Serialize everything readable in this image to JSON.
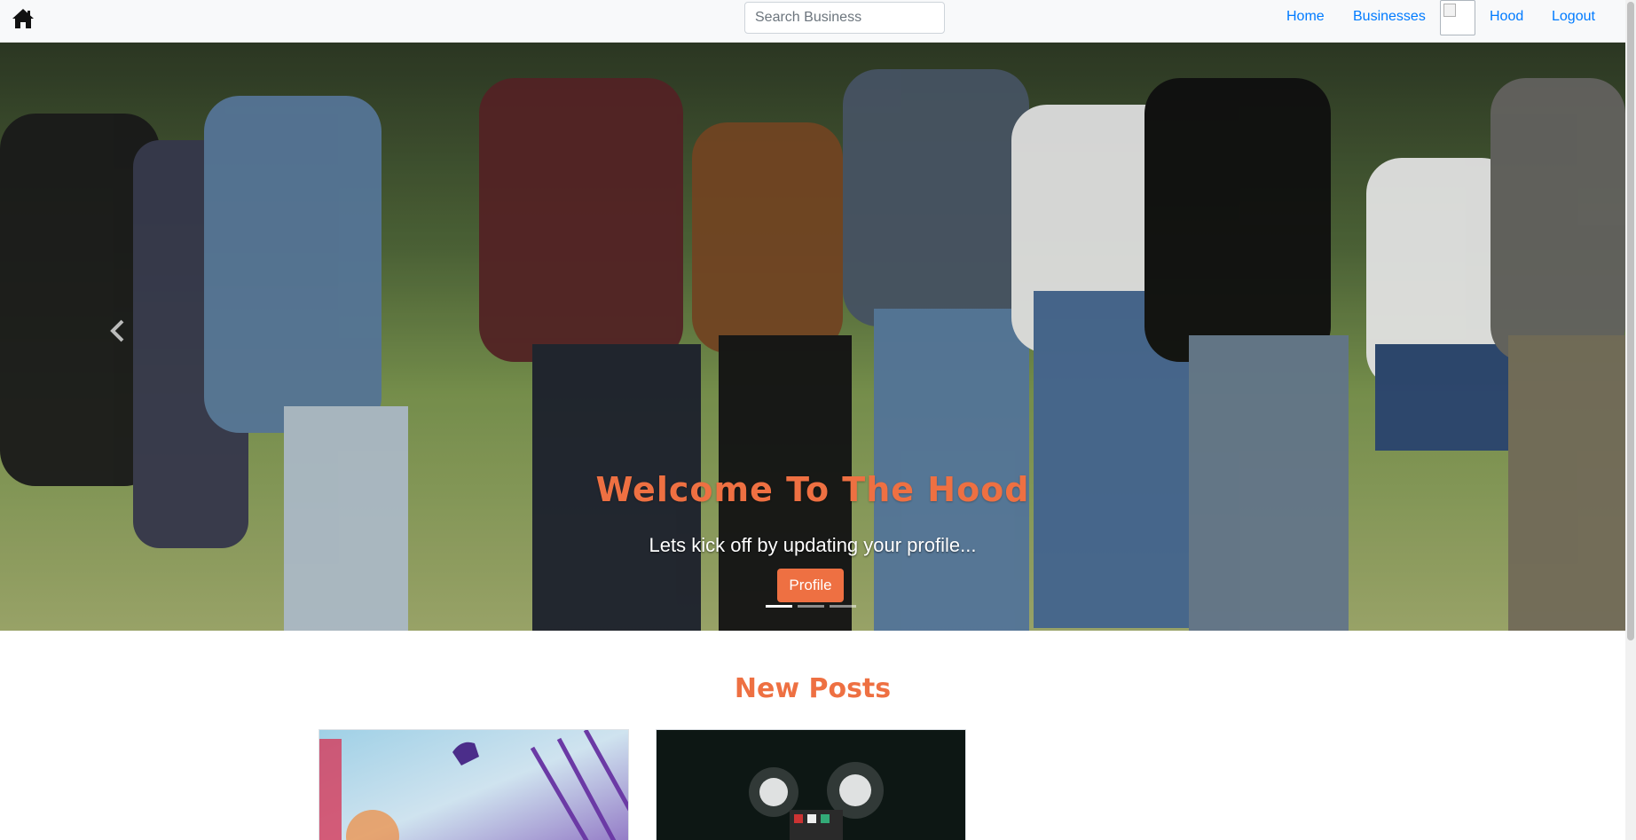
{
  "navbar": {
    "brand_icon": "home-icon",
    "search_placeholder": "Search Business",
    "links": {
      "home": "Home",
      "businesses": "Businesses",
      "hood": "Hood",
      "logout": "Logout"
    },
    "link_color": "#007bff"
  },
  "hero": {
    "title": "Welcome To The Hood",
    "subtitle": "Lets kick off by updating your profile...",
    "button_label": "Profile",
    "prev_icon": "chevron-left-icon",
    "slide_count": 3,
    "active_slide": 1,
    "accent_color": "#ee7042"
  },
  "posts": {
    "heading": "New Posts"
  }
}
